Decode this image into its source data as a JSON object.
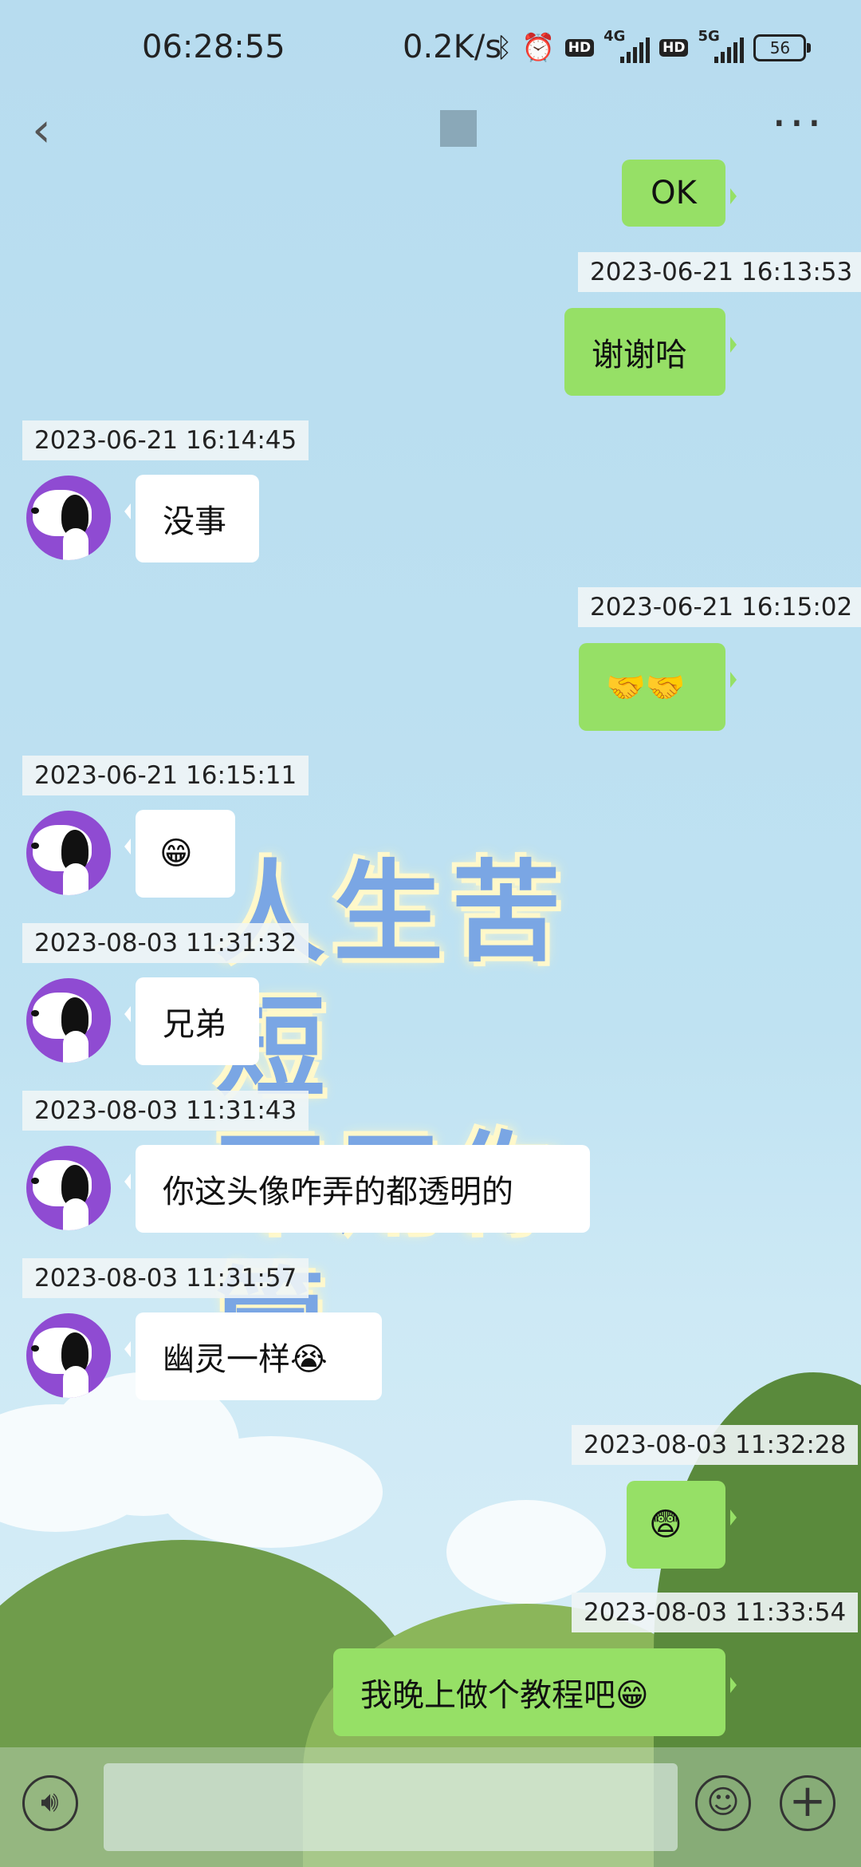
{
  "status_bar": {
    "time": "06:28:55",
    "net_speed": "0.2K/s",
    "hd1": "HD",
    "sig1": "4G",
    "hd2": "HD",
    "sig2": "5G",
    "battery": "56"
  },
  "nav": {
    "back_glyph": "‹",
    "more_glyph": "···"
  },
  "wallpaper": {
    "line1": "人生苦短",
    "line2": "不用你管"
  },
  "messages": [
    {
      "side": "right",
      "text": "OK"
    },
    {
      "side": "right",
      "ts": "2023-06-21 16:13:53",
      "text": "谢谢哈"
    },
    {
      "side": "left",
      "ts": "2023-06-21 16:14:45",
      "text": "没事"
    },
    {
      "side": "right",
      "ts": "2023-06-21 16:15:02",
      "text": "🤝🤝"
    },
    {
      "side": "left",
      "ts": "2023-06-21 16:15:11",
      "text": "😁"
    },
    {
      "side": "left",
      "ts": "2023-08-03 11:31:32",
      "text": "兄弟"
    },
    {
      "side": "left",
      "ts": "2023-08-03 11:31:43",
      "text": "你这头像咋弄的都透明的"
    },
    {
      "side": "left",
      "ts": "2023-08-03 11:31:57",
      "text": "幽灵一样😭"
    },
    {
      "side": "right",
      "ts": "2023-08-03 11:32:28",
      "text": "😨"
    },
    {
      "side": "right",
      "ts": "2023-08-03 11:33:54",
      "text": "我晚上做个教程吧😁"
    }
  ],
  "input_bar": {
    "voice_icon": "voice-icon",
    "emoji_icon": "emoji-icon",
    "plus_icon": "plus-icon"
  }
}
